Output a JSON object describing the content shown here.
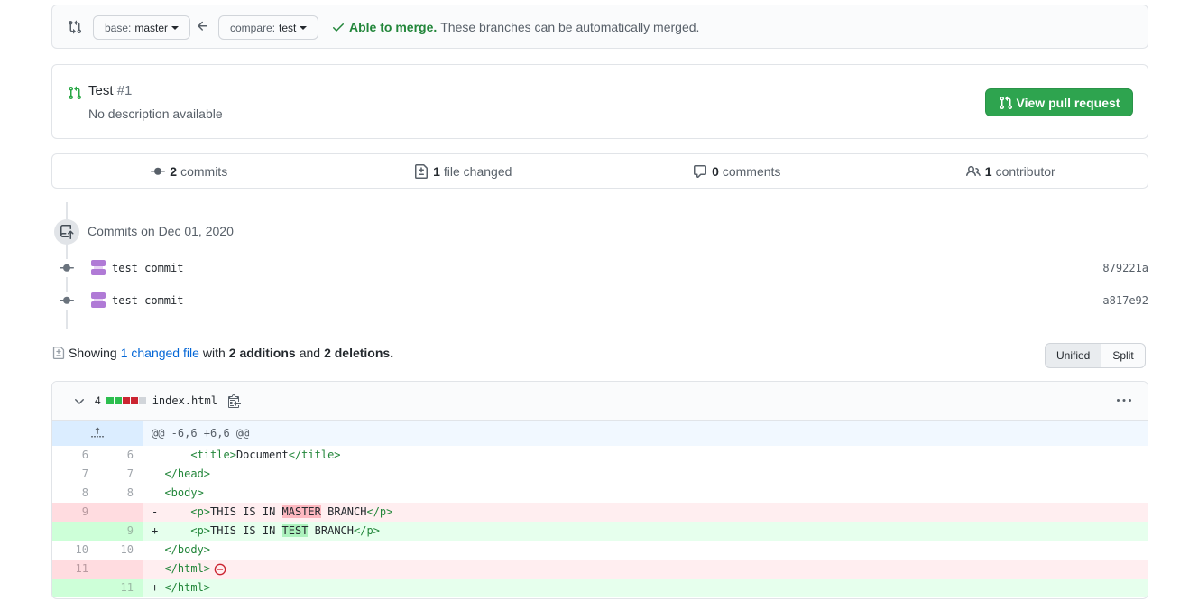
{
  "compare": {
    "base_prefix": "base:",
    "base_branch": "master",
    "compare_prefix": "compare:",
    "compare_branch": "test",
    "merge_ok": "Able to merge.",
    "merge_text": "These branches can be automatically merged."
  },
  "pull_request": {
    "title": "Test",
    "number": "#1",
    "description": "No description available",
    "view_button": "View pull request"
  },
  "summary": {
    "commits_count": "2",
    "commits_label": "commits",
    "files_count": "1",
    "files_label": "file changed",
    "comments_count": "0",
    "comments_label": "comments",
    "contributors_count": "1",
    "contributors_label": "contributor"
  },
  "commits": {
    "date_heading": "Commits on Dec 01, 2020",
    "items": [
      {
        "message": "test commit",
        "sha": "879221a"
      },
      {
        "message": "test commit",
        "sha": "a817e92"
      }
    ]
  },
  "diff_toolbar": {
    "showing": "Showing",
    "changed_files": "1 changed file",
    "with": "with",
    "additions_count": "2 additions",
    "and": "and",
    "deletions_count": "2 deletions.",
    "unified_label": "Unified",
    "split_label": "Split"
  },
  "file": {
    "change_count": "4",
    "name": "index.html",
    "hunk_header": "@@ -6,6 +6,6 @@",
    "lines": [
      {
        "old": "6",
        "new": "6"
      },
      {
        "old": "7",
        "new": "7"
      },
      {
        "old": "8",
        "new": "8"
      },
      {
        "old": "9",
        "new": ""
      },
      {
        "old": "",
        "new": "9"
      },
      {
        "old": "10",
        "new": "10"
      },
      {
        "old": "11",
        "new": ""
      },
      {
        "old": "",
        "new": "11"
      }
    ]
  },
  "colors": {
    "success": "#2ea44f",
    "link": "#0366d6",
    "deletion_bg": "#ffeef0",
    "addition_bg": "#e6ffed"
  }
}
